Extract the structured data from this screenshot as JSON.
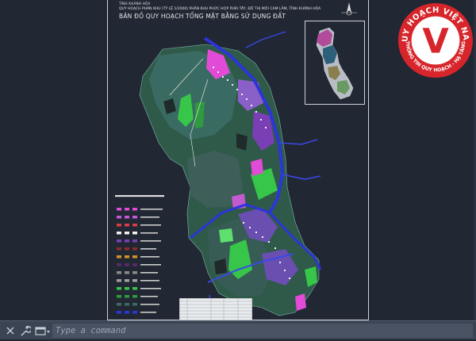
{
  "drawing": {
    "province": "TỈNH KHÁNH HÒA",
    "project_title": "QUY HOẠCH PHÂN KHU (TỶ LỆ 1/2000) PHÂN KHU PHỨC HỢP PHÍA TÂY, ĐÔ THỊ MỚI CAM LÂM, TỈNH KHÁNH HÒA",
    "sheet_title": "BẢN ĐỒ QUY HOẠCH TỔNG MẶT BẰNG SỬ DỤNG ĐẤT"
  },
  "watermark": {
    "brand_top": "QUY HOẠCH VIỆT NAM",
    "letter": "V",
    "brand_bottom": "THÔNG TIN QUY HOẠCH - HẠ TẦNG",
    "colors": {
      "red": "#d7262b",
      "white": "#ffffff"
    }
  },
  "command_line": {
    "close_icon": "close-icon",
    "wrench_icon": "wrench-icon",
    "command_icon": "command-window-icon",
    "placeholder": "Type a command"
  },
  "colors": {
    "background": "#212733",
    "land_dark_green": "#2f5a4a",
    "land_teal": "#3a6b63",
    "park_green": "#37c64a",
    "road_blue": "#2b35d8",
    "residential_pink": "#e24ad8",
    "residential_purple": "#7b3fb5"
  }
}
